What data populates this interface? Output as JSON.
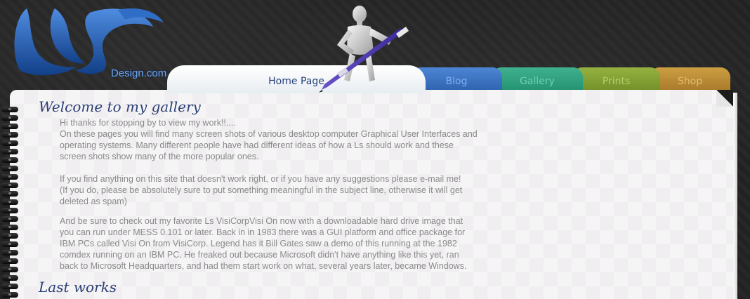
{
  "logo": {
    "domain_text": "Design.com"
  },
  "nav": {
    "tabs": [
      {
        "label": "Home Page"
      },
      {
        "label": "Blog"
      },
      {
        "label": "Gallery"
      },
      {
        "label": "Prints"
      },
      {
        "label": "Shop"
      }
    ]
  },
  "main": {
    "welcome_heading": "Welcome to my gallery",
    "p1_l1": "Hi thanks for stopping by to view my work!!....",
    "p1_l2": "On these pages you will find many screen shots of various desktop computer Graphical User Interfaces and",
    "p1_l3": "operating systems. Many different people have had different ideas of how a Ls should work and these",
    "p1_l4": "screen shots show many of the more popular ones.",
    "p2_l1": "If you find anything on this site that doesn't work right, or if you have any suggestions please e-mail me!",
    "p2_l2": "(If you do, please be absolutely sure to put something meaningful in the subject line, otherwise it will get",
    "p2_l3": "deleted as spam)",
    "p3_l1": "And be sure to check out my favorite Ls VisiCorpVisi On now with a downloadable hard drive image that",
    "p3_l2": "you can run under MESS 0.101 or later. Back in in 1983 there was a GUI platform and office package for",
    "p3_l3": "IBM PCs called Visi On from VisiCorp. Legend has it Bill Gates saw a demo of this running at the 1982",
    "p3_l4": "comdex running on an IBM PC. He freaked out because Microsoft didn't have anything like this yet, ran",
    "p3_l5": "back to Microsoft Headquarters, and had them start work on what, several years later, became Windows.",
    "last_works_heading": "Last works"
  },
  "colors": {
    "heading": "#2a3f75",
    "body_text": "#8a8a8a",
    "blog_tab": "#3b74c6",
    "gallery_tab": "#32a481",
    "prints_tab": "#86a336",
    "shop_tab": "#bf8f37"
  },
  "icons": {
    "logo": "ls-logo-icon",
    "mannequin": "mannequin-with-pen-icon",
    "rings": "spiral-binding-icon"
  }
}
